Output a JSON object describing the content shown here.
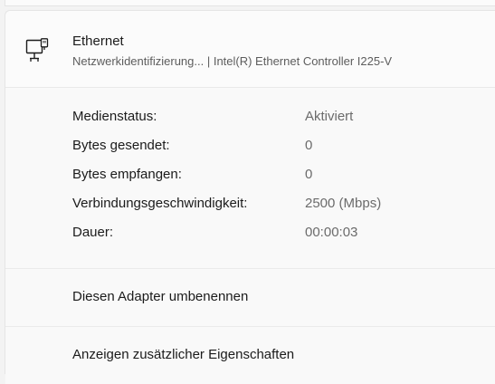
{
  "adapter": {
    "icon": "ethernet-adapter-icon",
    "title": "Ethernet",
    "subtitle": "Netzwerkidentifizierung... | Intel(R) Ethernet Controller I225-V"
  },
  "details": [
    {
      "label": "Medienstatus:",
      "value": "Aktiviert"
    },
    {
      "label": "Bytes gesendet:",
      "value": "0"
    },
    {
      "label": "Bytes empfangen:",
      "value": "0"
    },
    {
      "label": "Verbindungsgeschwindigkeit:",
      "value": "2500 (Mbps)"
    },
    {
      "label": "Dauer:",
      "value": "00:00:03"
    }
  ],
  "actions": {
    "rename_label": "Diesen Adapter umbenennen",
    "properties_label": "Anzeigen zusätzlicher Eigenschaften"
  }
}
